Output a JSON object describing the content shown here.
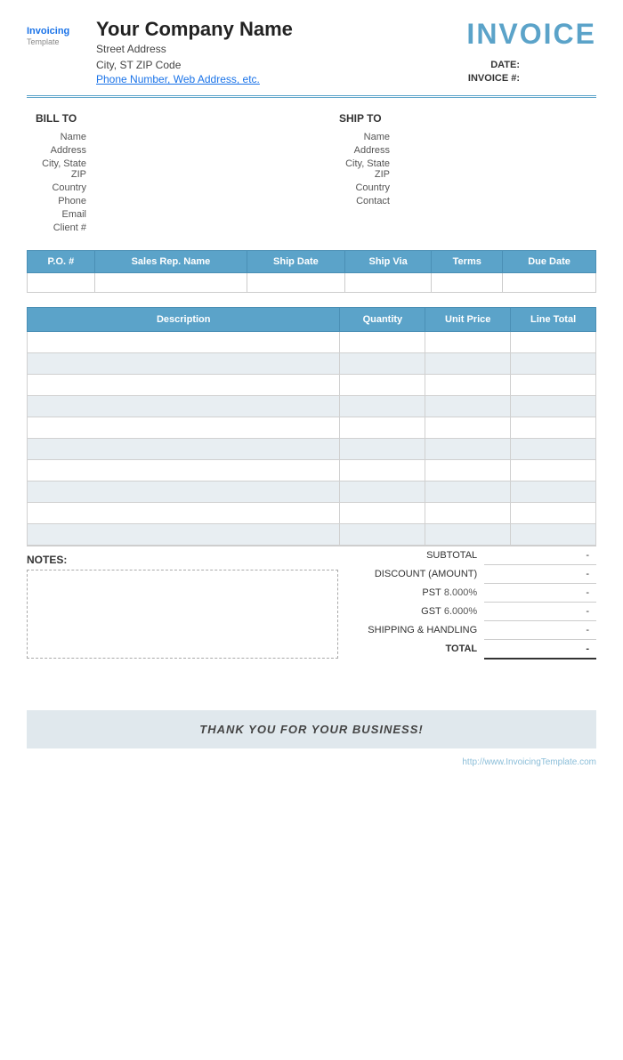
{
  "header": {
    "company_name": "Your Company Name",
    "street_address": "Street Address",
    "city_state_zip": "City, ST  ZIP Code",
    "phone_web": "Phone Number, Web Address, etc.",
    "invoice_title": "INVOICE",
    "date_label": "DATE:",
    "date_value": "",
    "invoice_num_label": "INVOICE #:",
    "invoice_num_value": ""
  },
  "bill_to": {
    "heading": "BILL TO",
    "fields": [
      {
        "label": "Name",
        "value": "Name"
      },
      {
        "label": "Address",
        "value": "Address"
      },
      {
        "label": "City, State ZIP",
        "value": "City, State ZIP"
      },
      {
        "label": "Country",
        "value": "Country"
      },
      {
        "label": "Phone",
        "value": "Phone"
      },
      {
        "label": "Email",
        "value": "Email"
      },
      {
        "label": "Client #",
        "value": "Client #"
      }
    ]
  },
  "ship_to": {
    "heading": "SHIP TO",
    "fields": [
      {
        "label": "Name",
        "value": "Name"
      },
      {
        "label": "Address",
        "value": "Address"
      },
      {
        "label": "City, State ZIP",
        "value": "City, State ZIP"
      },
      {
        "label": "Country",
        "value": "Country"
      },
      {
        "label": "Contact",
        "value": "Contact"
      }
    ]
  },
  "info_table": {
    "headers": [
      "P.O. #",
      "Sales Rep. Name",
      "Ship Date",
      "Ship Via",
      "Terms",
      "Due Date"
    ],
    "row": [
      "",
      "",
      "",
      "",
      "",
      ""
    ]
  },
  "items_table": {
    "headers": [
      "Description",
      "Quantity",
      "Unit Price",
      "Line Total"
    ],
    "rows": [
      [
        "",
        "",
        "",
        ""
      ],
      [
        "",
        "",
        "",
        ""
      ],
      [
        "",
        "",
        "",
        ""
      ],
      [
        "",
        "",
        "",
        ""
      ],
      [
        "",
        "",
        "",
        ""
      ],
      [
        "",
        "",
        "",
        ""
      ],
      [
        "",
        "",
        "",
        ""
      ],
      [
        "",
        "",
        "",
        ""
      ],
      [
        "",
        "",
        "",
        ""
      ],
      [
        "",
        "",
        "",
        ""
      ]
    ]
  },
  "totals": {
    "subtotal_label": "SUBTOTAL",
    "subtotal_value": "-",
    "discount_label": "DISCOUNT (AMOUNT)",
    "discount_value": "-",
    "pst_label": "PST",
    "pst_rate": "8.000%",
    "pst_value": "-",
    "gst_label": "GST",
    "gst_rate": "6.000%",
    "gst_value": "-",
    "shipping_label": "SHIPPING & HANDLING",
    "shipping_value": "-",
    "total_label": "TOTAL",
    "total_value": "-"
  },
  "notes": {
    "label": "NOTES:"
  },
  "footer": {
    "thank_you": "THANK YOU FOR YOUR BUSINESS!",
    "watermark": "http://www.InvoicingTemplate.com"
  },
  "logo": {
    "invoicing_color1": "#1a73e8",
    "invoicing_color2": "#e53935",
    "invoicing_color3": "#43a047",
    "template_color": "#888"
  }
}
